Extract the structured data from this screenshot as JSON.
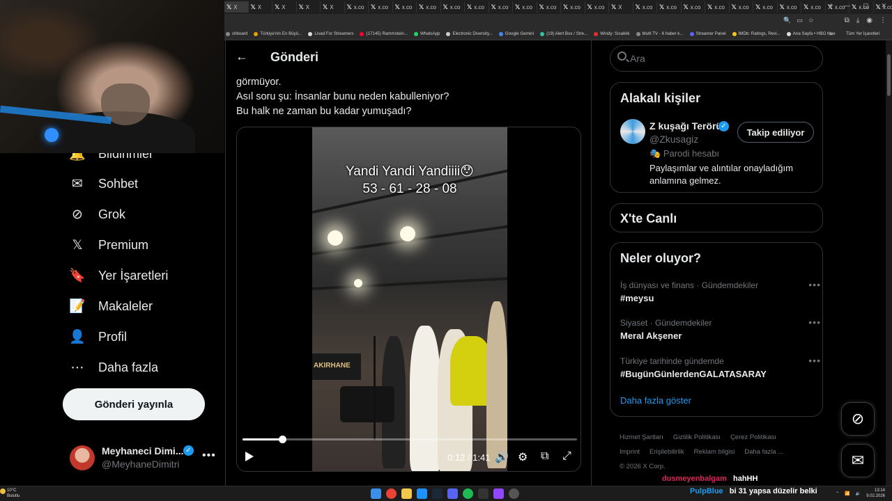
{
  "browser": {
    "tabs": [
      "X",
      "X",
      "X",
      "X",
      "X",
      "x.co",
      "x.co",
      "x.co",
      "x.co",
      "x.co",
      "x.co",
      "x.co",
      "x.co",
      "x.co",
      "x.co",
      "x.co",
      "X",
      "x.co",
      "x.co",
      "x.co",
      "x.co",
      "x.co",
      "x.co",
      "x.co",
      "x.co",
      "x.co",
      "x.co",
      "x.co"
    ],
    "bookmarks": [
      {
        "label": "shboard",
        "color": "#888888"
      },
      {
        "label": "Türkiye'nin En Büyü...",
        "color": "#e8a000"
      },
      {
        "label": "Livad For Streamers",
        "color": "#dddddd"
      },
      {
        "label": "(17145) Rammstein...",
        "color": "#ff0033"
      },
      {
        "label": "WhatsApp",
        "color": "#25d366"
      },
      {
        "label": "Electronic Diversity...",
        "color": "#cccccc"
      },
      {
        "label": "Google Gemini",
        "color": "#4285f4"
      },
      {
        "label": "(19) Alert Box / Stre...",
        "color": "#31c3a2"
      },
      {
        "label": "Windy: Sıcaklık",
        "color": "#e03030"
      },
      {
        "label": "Multi TV - 6 haber k...",
        "color": "#888888"
      },
      {
        "label": "Streamer Panel",
        "color": "#5865f2"
      },
      {
        "label": "IMDb: Ratings, Revi...",
        "color": "#f5c518"
      },
      {
        "label": "Ana Sayfa • HBO Max",
        "color": "#dddddd"
      }
    ],
    "bookmarks_all": "Tüm Yer İşaretleri",
    "bookmarks_more": "»"
  },
  "nav": {
    "items": [
      {
        "label": "Bildirimler",
        "icon": "bell-icon",
        "glyph": "🔔"
      },
      {
        "label": "Sohbet",
        "icon": "mail-icon",
        "glyph": "✉"
      },
      {
        "label": "Grok",
        "icon": "grok-icon",
        "glyph": "⊘"
      },
      {
        "label": "Premium",
        "icon": "x-logo-icon",
        "glyph": "𝕏"
      },
      {
        "label": "Yer İşaretleri",
        "icon": "bookmark-icon",
        "glyph": "🔖"
      },
      {
        "label": "Makaleler",
        "icon": "article-icon",
        "glyph": "📝"
      },
      {
        "label": "Profil",
        "icon": "person-icon",
        "glyph": "👤"
      },
      {
        "label": "Daha fazla",
        "icon": "more-circle-icon",
        "glyph": "⋯"
      }
    ],
    "post_button": "Gönderi yayınla",
    "account": {
      "name": "Meyhaneci Dimi...",
      "handle": "@MeyhaneDimitri",
      "more": "•••"
    }
  },
  "main": {
    "title": "Gönderi",
    "post_lines": [
      "görmüyor.",
      "Asıl soru şu: İnsanlar bunu neden kabulleniyor?",
      "Bu halk ne zaman bu kadar yumuşadı?"
    ],
    "video": {
      "overlay_title": "Yandi Yandi Yandiiii😯",
      "overlay_numbers": "53 - 61 - 28 - 08",
      "sign_text": "AKIRHANE",
      "time": "0:12 / 1:41",
      "progress": 0.119
    }
  },
  "right": {
    "search_placeholder": "Ara",
    "related": {
      "title": "Alakalı kişiler",
      "name": "Z kuşağı Terörü",
      "handle": "@Zkusagiz",
      "parody": "Parodi hesabı",
      "bio": "Paylaşımlar ve alıntılar onayladığım anlamına gelmez.",
      "follow_label": "Takip ediliyor"
    },
    "live": {
      "title": "X'te Canlı"
    },
    "trends": {
      "title": "Neler oluyor?",
      "items": [
        {
          "category": "İş dünyası ve finans · Gündemdekiler",
          "name": "#meysu"
        },
        {
          "category": "Siyaset · Gündemdekiler",
          "name": "Meral Akşener"
        },
        {
          "category": "Türkiye tarihinde gündemde",
          "name": "#BugünGünlerdenGALATASARAY"
        }
      ],
      "show_more": "Daha fazla göster"
    },
    "footer": [
      "Hizmet Şartları",
      "Gizlilik Politikası",
      "Çerez Politikası",
      "Imprint",
      "Erişilebilirlik",
      "Reklam bilgisi",
      "Daha fazla ...",
      "© 2026 X Corp."
    ]
  },
  "chat": [
    {
      "user": "dusmeyenbalgam",
      "msg": "hahHH"
    },
    {
      "user": "PulpBlue",
      "msg": "bi 31 yapsa düzelir belki"
    }
  ],
  "taskbar": {
    "weather_temp": "10°C",
    "weather_desc": "Bulutlu",
    "time": "13:14",
    "date": "9.02.2026",
    "lang": "TR"
  }
}
